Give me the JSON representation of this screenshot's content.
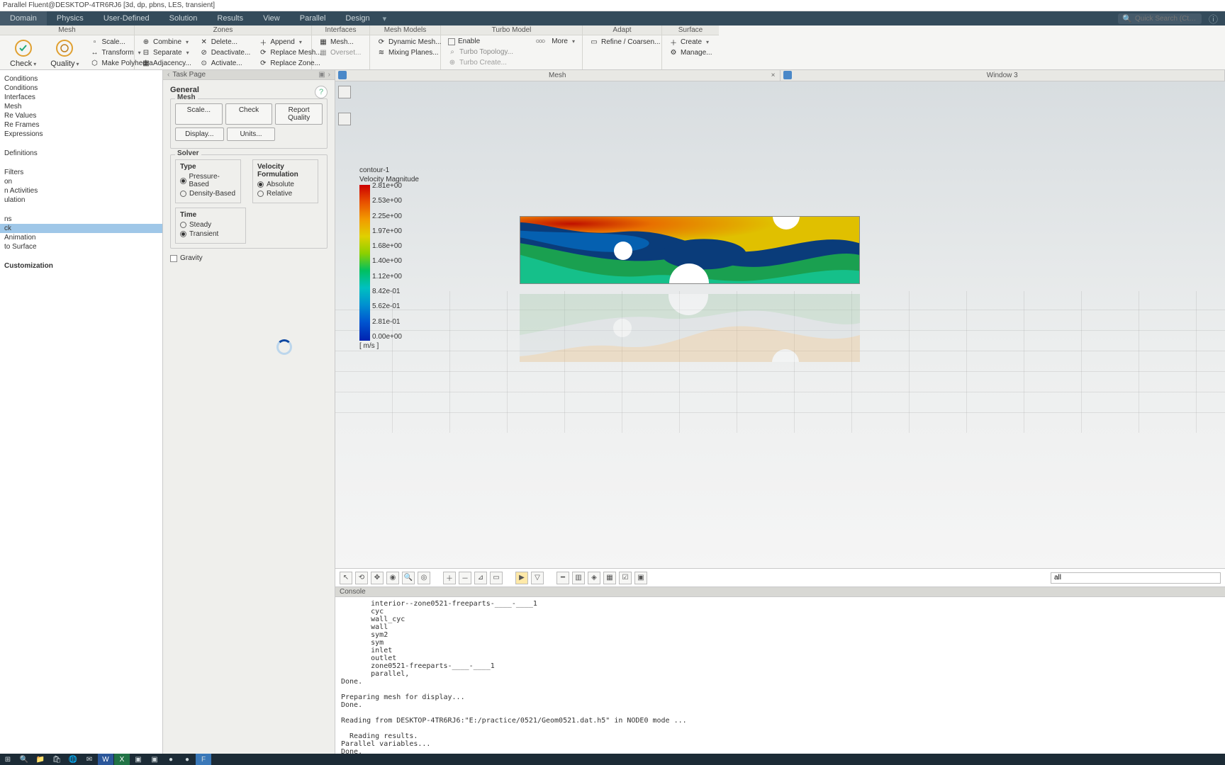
{
  "title": "Parallel Fluent@DESKTOP-4TR6RJ6  [3d, dp, pbns, LES, transient]",
  "menubar": [
    "Domain",
    "Physics",
    "User-Defined",
    "Solution",
    "Results",
    "View",
    "Parallel",
    "Design"
  ],
  "search_placeholder": "Quick Search (Ct…",
  "ribbon": {
    "mesh": {
      "title": "Mesh",
      "big": [
        {
          "label": "Check",
          "dd": true
        },
        {
          "label": "Quality",
          "dd": true
        }
      ],
      "col1": [
        {
          "label": "Scale..."
        },
        {
          "label": "Transform",
          "dd": true
        },
        {
          "label": "Make Polyhedra"
        }
      ]
    },
    "zones": {
      "title": "Zones",
      "cols": [
        [
          {
            "label": "Combine",
            "dd": true
          },
          {
            "label": "Separate",
            "dd": true
          },
          {
            "label": "Adjacency..."
          }
        ],
        [
          {
            "label": "Delete..."
          },
          {
            "label": "Deactivate..."
          },
          {
            "label": "Activate..."
          }
        ],
        [
          {
            "label": "Append",
            "dd": true
          },
          {
            "label": "Replace Mesh..."
          },
          {
            "label": "Replace Zone..."
          }
        ]
      ]
    },
    "interfaces": {
      "title": "Interfaces",
      "items": [
        {
          "label": "Mesh..."
        },
        {
          "label": "Overset..."
        }
      ]
    },
    "meshmodels": {
      "title": "Mesh Models",
      "items": [
        {
          "label": "Dynamic Mesh..."
        },
        {
          "label": "Mixing Planes..."
        }
      ]
    },
    "turbo": {
      "title": "Turbo Model",
      "items": [
        {
          "label": "Enable"
        },
        {
          "label": "Turbo Topology..."
        },
        {
          "label": "Turbo Create..."
        }
      ],
      "more": "More"
    },
    "adapt": {
      "title": "Adapt",
      "items": [
        {
          "label": "Refine / Coarsen..."
        }
      ]
    },
    "surface": {
      "title": "Surface",
      "items": [
        {
          "label": "Create",
          "dd": true
        },
        {
          "label": "Manage..."
        }
      ]
    }
  },
  "tree": [
    {
      "label": "Conditions"
    },
    {
      "label": "Conditions"
    },
    {
      "label": "Interfaces"
    },
    {
      "label": "Mesh"
    },
    {
      "label": "Re Values"
    },
    {
      "label": "Re Frames"
    },
    {
      "label": "Expressions"
    },
    {
      "spacer": true
    },
    {
      "label": "Definitions"
    },
    {
      "spacer": true
    },
    {
      "label": "Filters"
    },
    {
      "label": "on"
    },
    {
      "label": "n Activities"
    },
    {
      "label": "ulation"
    },
    {
      "spacer": true
    },
    {
      "label": "ns"
    },
    {
      "label": "ck",
      "sel": true
    },
    {
      "label": "Animation"
    },
    {
      "label": "to Surface"
    },
    {
      "spacer": true
    },
    {
      "label": "Customization",
      "bold": true
    }
  ],
  "task": {
    "head": "Task Page",
    "general": "General",
    "mesh": {
      "title": "Mesh",
      "row1": [
        "Scale...",
        "Check",
        "Report Quality"
      ],
      "row2": [
        "Display...",
        "Units..."
      ]
    },
    "solver": {
      "title": "Solver",
      "type": {
        "title": "Type",
        "opts": [
          "Pressure-Based",
          "Density-Based"
        ],
        "sel": 0
      },
      "vel": {
        "title": "Velocity Formulation",
        "opts": [
          "Absolute",
          "Relative"
        ],
        "sel": 0
      },
      "time": {
        "title": "Time",
        "opts": [
          "Steady",
          "Transient"
        ],
        "sel": 1
      }
    },
    "gravity": "Gravity"
  },
  "viewport": {
    "tabs": [
      {
        "label": "Mesh",
        "close": true
      },
      {
        "label": "Window 3"
      }
    ],
    "contour": {
      "name": "contour-1",
      "field": "Velocity Magnitude",
      "unit": "[ m/s ]"
    },
    "legend_ticks": [
      "2.81e+00",
      "2.53e+00",
      "2.25e+00",
      "1.97e+00",
      "1.68e+00",
      "1.40e+00",
      "1.12e+00",
      "8.42e-01",
      "5.62e-01",
      "2.81e-01",
      "0.00e+00"
    ],
    "toolbar_filter": "all"
  },
  "console": {
    "title": "Console",
    "text": "       interior--zone0521-freeparts-____-____1\n       cyc\n       wall_cyc\n       wall\n       sym2\n       sym\n       inlet\n       outlet\n       zone0521-freeparts-____-____1\n       parallel,\nDone.\n\nPreparing mesh for display...\nDone.\n\nReading from DESKTOP-4TR6RJ6:\"E:/practice/0521/Geom0521.dat.h5\" in NODE0 mode ...\n\n  Reading results.\nParallel variables...\nDone."
  },
  "chart_data": {
    "type": "heatmap",
    "title": "contour-1 — Velocity Magnitude",
    "field": "Velocity Magnitude",
    "unit": "m/s",
    "range": [
      0.0,
      2.81
    ],
    "colorbar_ticks": [
      0.0,
      0.281,
      0.562,
      0.842,
      1.12,
      1.4,
      1.68,
      1.97,
      2.25,
      2.53,
      2.81
    ],
    "colormap": "rainbow",
    "geometry": "rectangular duct with three circular obstacles; flow left→right; high velocity (red/orange) along top-left inlet shear layer, recirculation / low velocity (blue) mid-channel and behind cylinders",
    "obstacles": [
      {
        "shape": "circle",
        "cx_rel": 0.3,
        "cy_rel": 0.5,
        "r_rel": 0.13
      },
      {
        "shape": "half-circle-bottom",
        "cx_rel": 0.49,
        "cy_rel": 1.0,
        "r_rel": 0.24
      },
      {
        "shape": "half-circle-top",
        "cx_rel": 0.78,
        "cy_rel": 0.0,
        "r_rel": 0.16
      }
    ]
  }
}
